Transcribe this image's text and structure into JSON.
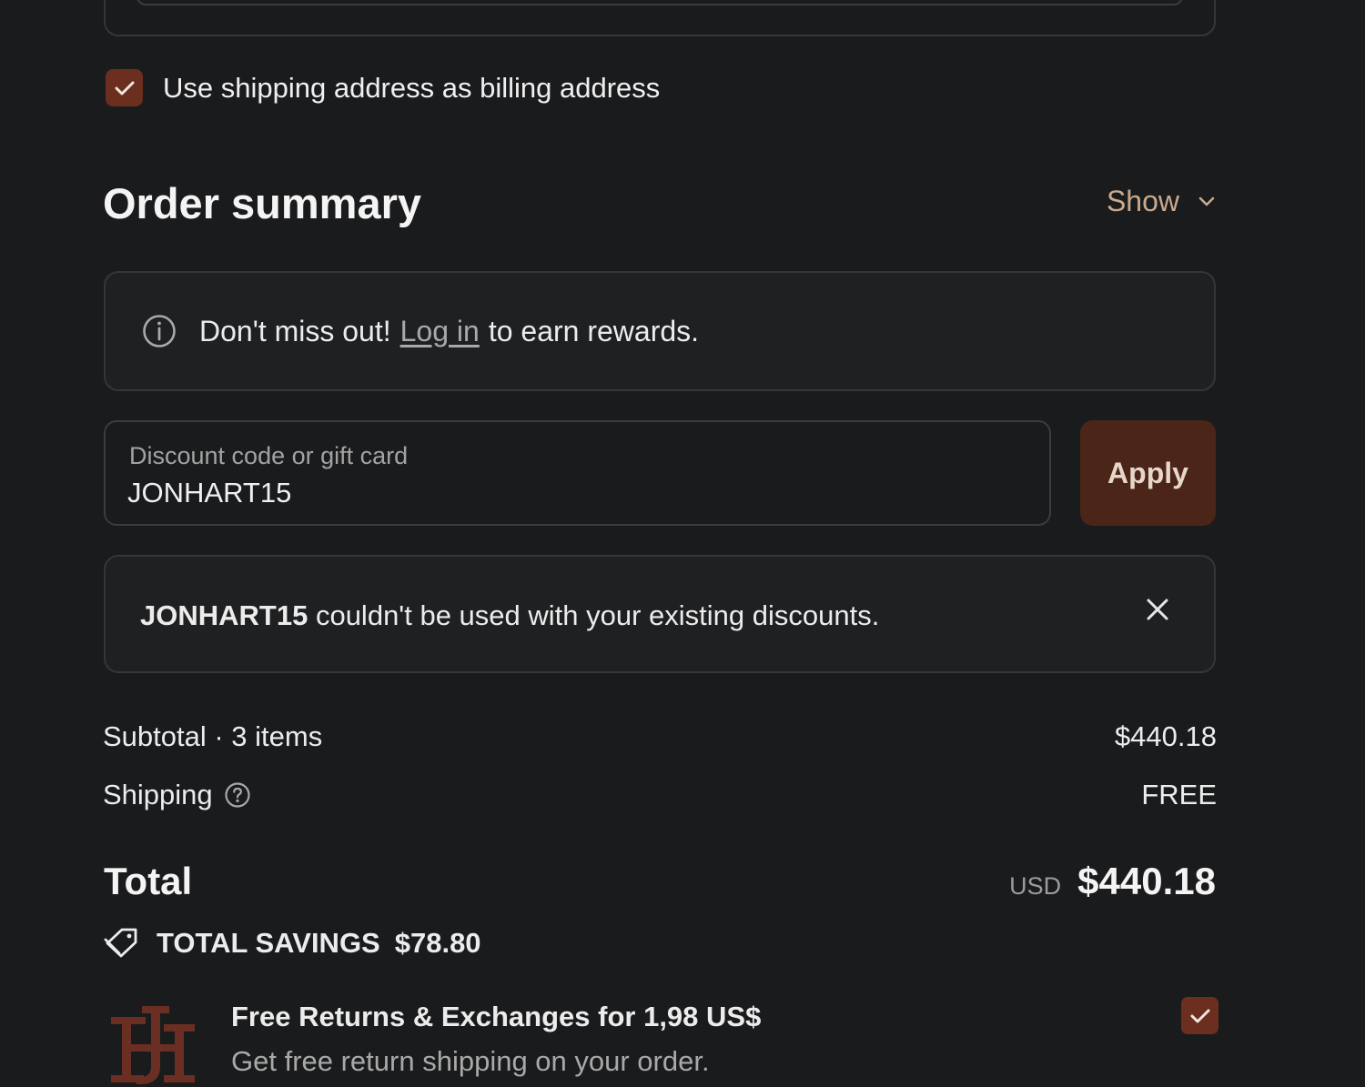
{
  "billing": {
    "checkbox_label": "Use shipping address as billing address",
    "checked": true
  },
  "summary": {
    "title": "Order summary",
    "toggle_label": "Show"
  },
  "rewards": {
    "prefix": "Don't miss out!",
    "link": "Log in",
    "suffix": "to earn rewards."
  },
  "discount": {
    "label": "Discount code or gift card",
    "value": "JONHART15",
    "apply_label": "Apply"
  },
  "error": {
    "code": "JONHART15",
    "message": "couldn't be used with your existing discounts."
  },
  "totals": {
    "subtotal_label": "Subtotal · 3 items",
    "subtotal_value": "$440.18",
    "shipping_label": "Shipping",
    "shipping_value": "FREE",
    "total_label": "Total",
    "currency": "USD",
    "total_value": "$440.18",
    "savings_label": "TOTAL SAVINGS",
    "savings_value": "$78.80"
  },
  "returns": {
    "title": "Free Returns & Exchanges for 1,98 US$",
    "subtitle": "Get free return shipping on your order.",
    "checked": true
  },
  "colors": {
    "accent": "#6b2e1f",
    "apply_bg": "#4a2518",
    "show_link": "#c9a98e",
    "background": "#1a1b1d"
  },
  "icons": {
    "billing_check": "check-icon",
    "show_chevron": "chevron-down-icon",
    "rewards_info": "info-icon",
    "error_close": "close-icon",
    "shipping_help": "help-icon",
    "savings_tag": "tag-icon",
    "returns_logo": "brand-logo",
    "returns_check": "check-icon"
  }
}
